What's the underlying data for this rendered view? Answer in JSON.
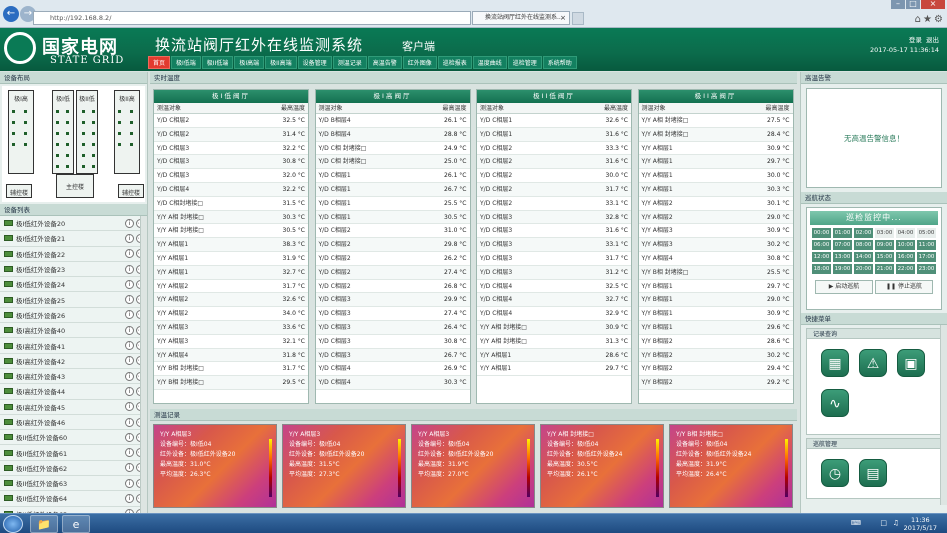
{
  "browser": {
    "address": "http://192.168.8.2/",
    "tab_title": "换流站阀厅红外在线监测系...",
    "tab_close": "×"
  },
  "header": {
    "logo_cn": "国家电网",
    "logo_en": "STATE GRID",
    "title": "换流站阀厅红外在线监测系统",
    "client": "客户端",
    "login": "登录",
    "logout": "退出",
    "datetime": "2017-05-17 11:36:14"
  },
  "menu": [
    "首页",
    "极I低端",
    "极II低端",
    "极I高端",
    "极II高端",
    "设备管理",
    "测温记录",
    "高温告警",
    "红外图像",
    "巡检报表",
    "温度曲线",
    "巡检管理",
    "系统帮助"
  ],
  "left": {
    "layout_title": "设备布局",
    "list_title": "设备列表",
    "valves": [
      "极I高",
      "极I低",
      "极II低",
      "极II高"
    ],
    "main_control": "主控楼",
    "aux1": "辅控楼",
    "aux2": "辅控楼",
    "devices": [
      "极I低红外设备20",
      "极I低红外设备21",
      "极I低红外设备22",
      "极I低红外设备23",
      "极I低红外设备24",
      "极I低红外设备25",
      "极I低红外设备26",
      "极I高红外设备40",
      "极I高红外设备41",
      "极I高红外设备42",
      "极I高红外设备43",
      "极I高红外设备44",
      "极I高红外设备45",
      "极I高红外设备46",
      "极II低红外设备60",
      "极II低红外设备61",
      "极II低红外设备62",
      "极II低红外设备63",
      "极II低红外设备64",
      "极II低红外设备65"
    ]
  },
  "mid": {
    "title": "实时温度",
    "col_obj": "测温对象",
    "col_max": "最高温度",
    "tables": [
      {
        "title": "极I低阀厅",
        "rows": [
          [
            "Y/D C相层2",
            "32.5 °C"
          ],
          [
            "Y/D C相层2",
            "31.4 °C"
          ],
          [
            "Y/D C相层3",
            "32.2 °C"
          ],
          [
            "Y/D C相层3",
            "30.8 °C"
          ],
          [
            "Y/D C相层3",
            "32.0 °C"
          ],
          [
            "Y/D C相层4",
            "32.2 °C"
          ],
          [
            "Y/D C相封堵接□",
            "31.5 °C"
          ],
          [
            "Y/Y A相 封堵接□",
            "30.3 °C"
          ],
          [
            "Y/Y A相 封堵接□",
            "30.5 °C"
          ],
          [
            "Y/Y A相层1",
            "38.3 °C"
          ],
          [
            "Y/Y A相层1",
            "31.9 °C"
          ],
          [
            "Y/Y A相层1",
            "32.7 °C"
          ],
          [
            "Y/Y A相层2",
            "31.7 °C"
          ],
          [
            "Y/Y A相层2",
            "32.6 °C"
          ],
          [
            "Y/Y A相层2",
            "34.0 °C"
          ],
          [
            "Y/Y A相层3",
            "33.6 °C"
          ],
          [
            "Y/Y A相层3",
            "32.1 °C"
          ],
          [
            "Y/Y A相层4",
            "31.8 °C"
          ],
          [
            "Y/Y B相 封堵接□",
            "31.7 °C"
          ],
          [
            "Y/Y B相 封堵接□",
            "29.5 °C"
          ]
        ]
      },
      {
        "title": "极I高阀厅",
        "rows": [
          [
            "Y/D B相层4",
            "26.1 °C"
          ],
          [
            "Y/D B相层4",
            "28.8 °C"
          ],
          [
            "Y/D C相 封堵接□",
            "24.9 °C"
          ],
          [
            "Y/D C相 封堵接□",
            "25.0 °C"
          ],
          [
            "Y/D C相层1",
            "26.1 °C"
          ],
          [
            "Y/D C相层1",
            "26.7 °C"
          ],
          [
            "Y/D C相层1",
            "25.5 °C"
          ],
          [
            "Y/D C相层1",
            "30.5 °C"
          ],
          [
            "Y/D C相层2",
            "31.0 °C"
          ],
          [
            "Y/D C相层2",
            "29.8 °C"
          ],
          [
            "Y/D C相层2",
            "26.2 °C"
          ],
          [
            "Y/D C相层2",
            "27.4 °C"
          ],
          [
            "Y/D C相层2",
            "26.8 °C"
          ],
          [
            "Y/D C相层3",
            "29.9 °C"
          ],
          [
            "Y/D C相层3",
            "27.4 °C"
          ],
          [
            "Y/D C相层3",
            "26.4 °C"
          ],
          [
            "Y/D C相层3",
            "30.8 °C"
          ],
          [
            "Y/D C相层3",
            "26.7 °C"
          ],
          [
            "Y/D C相层4",
            "26.9 °C"
          ],
          [
            "Y/D C相层4",
            "30.3 °C"
          ]
        ]
      },
      {
        "title": "极II低阀厅",
        "rows": [
          [
            "Y/D C相层1",
            "32.6 °C"
          ],
          [
            "Y/D C相层1",
            "31.6 °C"
          ],
          [
            "Y/D C相层2",
            "33.3 °C"
          ],
          [
            "Y/D C相层2",
            "31.6 °C"
          ],
          [
            "Y/D C相层2",
            "30.0 °C"
          ],
          [
            "Y/D C相层2",
            "31.7 °C"
          ],
          [
            "Y/D C相层2",
            "33.1 °C"
          ],
          [
            "Y/D C相层3",
            "32.8 °C"
          ],
          [
            "Y/D C相层3",
            "31.6 °C"
          ],
          [
            "Y/D C相层3",
            "33.1 °C"
          ],
          [
            "Y/D C相层3",
            "31.7 °C"
          ],
          [
            "Y/D C相层3",
            "31.2 °C"
          ],
          [
            "Y/D C相层4",
            "32.5 °C"
          ],
          [
            "Y/D C相层4",
            "32.7 °C"
          ],
          [
            "Y/D C相层4",
            "32.9 °C"
          ],
          [
            "Y/Y A相 封堵接□",
            "30.9 °C"
          ],
          [
            "Y/Y A相 封堵接□",
            "31.3 °C"
          ],
          [
            "Y/Y A相层1",
            "28.6 °C"
          ],
          [
            "Y/Y A相层1",
            "29.7 °C"
          ]
        ]
      },
      {
        "title": "极II高阀厅",
        "rows": [
          [
            "Y/Y A相 封堵接□",
            "27.5 °C"
          ],
          [
            "Y/Y A相 封堵接□",
            "28.4 °C"
          ],
          [
            "Y/Y A相层1",
            "30.9 °C"
          ],
          [
            "Y/Y A相层1",
            "29.7 °C"
          ],
          [
            "Y/Y A相层1",
            "30.0 °C"
          ],
          [
            "Y/Y A相层1",
            "30.3 °C"
          ],
          [
            "Y/Y A相层2",
            "30.1 °C"
          ],
          [
            "Y/Y A相层2",
            "29.0 °C"
          ],
          [
            "Y/Y A相层3",
            "30.9 °C"
          ],
          [
            "Y/Y A相层3",
            "30.2 °C"
          ],
          [
            "Y/Y A相层4",
            "30.8 °C"
          ],
          [
            "Y/Y B相 封堵接□",
            "25.5 °C"
          ],
          [
            "Y/Y B相层1",
            "29.7 °C"
          ],
          [
            "Y/Y B相层1",
            "29.0 °C"
          ],
          [
            "Y/Y B相层1",
            "30.9 °C"
          ],
          [
            "Y/Y B相层1",
            "29.6 °C"
          ],
          [
            "Y/Y B相层2",
            "28.6 °C"
          ],
          [
            "Y/Y B相层2",
            "30.2 °C"
          ],
          [
            "Y/Y B相层2",
            "29.4 °C"
          ],
          [
            "Y/Y B相层2",
            "29.2 °C"
          ]
        ]
      }
    ]
  },
  "therm": {
    "title": "测温记录",
    "cards": [
      {
        "obj": "Y/Y A相层3",
        "dev": "设备编号：极I低04",
        "loc": "红外设备：极I低红外设备20",
        "max": "最高温度：31.0°C",
        "avg": "平均温度：26.3°C"
      },
      {
        "obj": "Y/Y A相层3",
        "dev": "设备编号：极I低04",
        "loc": "红外设备：极I低红外设备20",
        "max": "最高温度：31.5°C",
        "avg": "平均温度：27.3°C"
      },
      {
        "obj": "Y/Y A相层3",
        "dev": "设备编号：极I低04",
        "loc": "红外设备：极I低红外设备20",
        "max": "最高温度：31.9°C",
        "avg": "平均温度：27.0°C"
      },
      {
        "obj": "Y/Y A相 封堵接□",
        "dev": "设备编号：极I低04",
        "loc": "红外设备：极I低红外设备24",
        "max": "最高温度：30.5°C",
        "avg": "平均温度：26.1°C"
      },
      {
        "obj": "Y/Y B相 封堵接□",
        "dev": "设备编号：极I低04",
        "loc": "红外设备：极I低红外设备24",
        "max": "最高温度：31.9°C",
        "avg": "平均温度：26.4°C"
      }
    ]
  },
  "right": {
    "alarm_title": "高温告警",
    "alarm_msg": "无高温告警信息！",
    "patrol_title": "巡航状态",
    "patrol_status": "巡检监控中...",
    "times": [
      "00:00",
      "01:00",
      "02:00",
      "03:00",
      "04:00",
      "05:00",
      "06:00",
      "07:00",
      "08:00",
      "09:00",
      "10:00",
      "11:00",
      "12:00",
      "13:00",
      "14:00",
      "15:00",
      "16:00",
      "17:00",
      "18:00",
      "19:00",
      "20:00",
      "21:00",
      "22:00",
      "23:00"
    ],
    "start": "启动巡航",
    "stop": "停止巡航",
    "quick_title": "快捷菜单",
    "quick_sub1": "记录查询",
    "quick_sub2": "巡航管理"
  },
  "taskbar": {
    "time": "11:36",
    "date": "2017/5/17"
  }
}
